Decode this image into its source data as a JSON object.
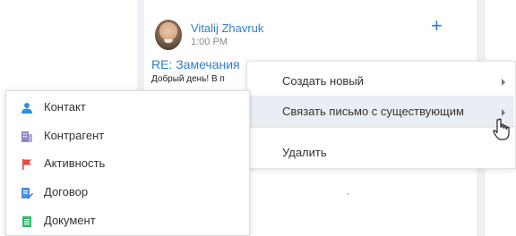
{
  "email": {
    "sender_name": "Vitalij Zhavruk",
    "time": "1:00 PM",
    "subject": "RE: Замечания",
    "preview": "Добрый день! В п"
  },
  "add_button_icon": "plus-icon",
  "context_menu": {
    "items": [
      {
        "label": "Создать новый",
        "has_submenu": true
      },
      {
        "label": "Связать письмо с существующим",
        "has_submenu": true,
        "highlighted": true
      },
      {
        "label": "Удалить",
        "has_submenu": false
      }
    ]
  },
  "submenu": {
    "items": [
      {
        "label": "Контакт",
        "icon": "contact-icon",
        "color": "#2f8fd8"
      },
      {
        "label": "Контрагент",
        "icon": "account-icon",
        "color": "#8e87c7"
      },
      {
        "label": "Активность",
        "icon": "activity-flag-icon",
        "color": "#e4473d"
      },
      {
        "label": "Договор",
        "icon": "contract-icon",
        "color": "#4b8fe0"
      },
      {
        "label": "Документ",
        "icon": "document-icon",
        "color": "#35b86b"
      }
    ]
  },
  "colors": {
    "link": "#337ecc",
    "menu_highlight": "#e8eef4"
  }
}
